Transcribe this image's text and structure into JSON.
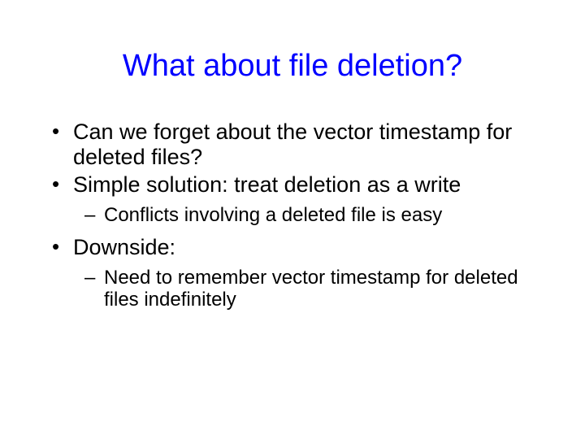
{
  "title": "What about file deletion?",
  "bullets": [
    {
      "text": "Can we forget about the vector timestamp for deleted files?",
      "sub": []
    },
    {
      "text": "Simple solution: treat deletion as a write",
      "sub": [
        "Conflicts involving a deleted file is easy"
      ]
    },
    {
      "text": "Downside:",
      "sub": [
        "Need to remember vector timestamp for deleted files indefinitely"
      ]
    }
  ]
}
